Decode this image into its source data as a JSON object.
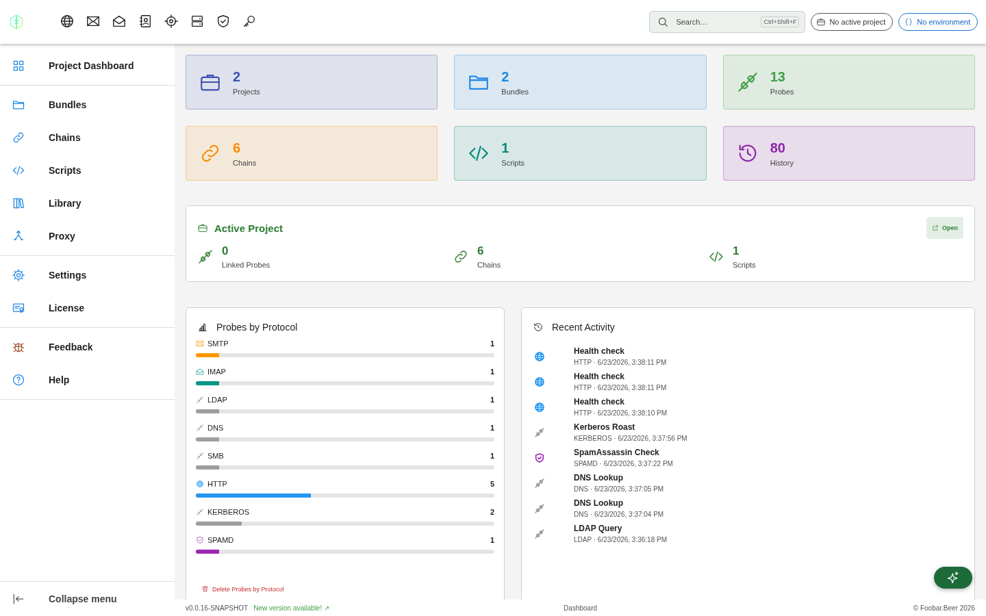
{
  "search": {
    "placeholder": "Search…",
    "shortcut": "Ctrl+Shift+F"
  },
  "project_chip": "No active project",
  "environment_chip": "No environment",
  "sidebar": {
    "groups": [
      [
        {
          "label": "Project Dashboard"
        }
      ],
      [
        {
          "label": "Bundles"
        },
        {
          "label": "Chains"
        },
        {
          "label": "Scripts"
        },
        {
          "label": "Library"
        },
        {
          "label": "Proxy"
        }
      ],
      [
        {
          "label": "Settings"
        },
        {
          "label": "License"
        }
      ],
      [
        {
          "label": "Feedback"
        },
        {
          "label": "Help"
        }
      ]
    ],
    "collapse": "Collapse menu"
  },
  "stats": [
    {
      "value": "2",
      "label": "Projects",
      "color": "#3f51b5"
    },
    {
      "value": "2",
      "label": "Bundles",
      "color": "#1e88e5"
    },
    {
      "value": "13",
      "label": "Probes",
      "color": "#43a047"
    },
    {
      "value": "6",
      "label": "Chains",
      "color": "#fb8c00"
    },
    {
      "value": "1",
      "label": "Scripts",
      "color": "#00897b"
    },
    {
      "value": "80",
      "label": "History",
      "color": "#8e24aa"
    }
  ],
  "active_project": {
    "title": "Active Project",
    "open": "Open",
    "metrics": [
      {
        "value": "0",
        "label": "Linked Probes"
      },
      {
        "value": "6",
        "label": "Chains"
      },
      {
        "value": "1",
        "label": "Scripts"
      }
    ]
  },
  "probes_by_protocol": {
    "title": "Probes by Protocol",
    "delete": "Delete Probes by Protocol",
    "rows": [
      {
        "name": "SMTP",
        "count": "1",
        "level": 0.077,
        "color": "#ff9800"
      },
      {
        "name": "IMAP",
        "count": "1",
        "level": 0.077,
        "color": "#009688"
      },
      {
        "name": "LDAP",
        "count": "1",
        "level": 0.077,
        "color": "#9e9e9e"
      },
      {
        "name": "DNS",
        "count": "1",
        "level": 0.077,
        "color": "#9e9e9e"
      },
      {
        "name": "SMB",
        "count": "1",
        "level": 0.077,
        "color": "#9e9e9e"
      },
      {
        "name": "HTTP",
        "count": "5",
        "level": 0.385,
        "color": "#2196f3"
      },
      {
        "name": "KERBEROS",
        "count": "2",
        "level": 0.154,
        "color": "#9e9e9e"
      },
      {
        "name": "SPAMD",
        "count": "1",
        "level": 0.077,
        "color": "#9c27b0"
      }
    ]
  },
  "recent_activity": {
    "title": "Recent Activity",
    "items": [
      {
        "title": "Health check",
        "meta": "HTTP · 6/23/2026, 3:38:11 PM",
        "color": "#2196f3"
      },
      {
        "title": "Health check",
        "meta": "HTTP · 6/23/2026, 3:38:11 PM",
        "color": "#2196f3"
      },
      {
        "title": "Health check",
        "meta": "HTTP · 6/23/2026, 3:38:10 PM",
        "color": "#2196f3"
      },
      {
        "title": "Kerberos Roast",
        "meta": "KERBEROS · 6/23/2026, 3:37:56 PM",
        "color": "#9e9e9e"
      },
      {
        "title": "SpamAssassin Check",
        "meta": "SPAMD · 6/23/2026, 3:37:22 PM",
        "color": "#9c27b0"
      },
      {
        "title": "DNS Lookup",
        "meta": "DNS · 6/23/2026, 3:37:05 PM",
        "color": "#9e9e9e"
      },
      {
        "title": "DNS Lookup",
        "meta": "DNS · 6/23/2026, 3:37:04 PM",
        "color": "#9e9e9e"
      },
      {
        "title": "LDAP Query",
        "meta": "LDAP · 6/23/2026, 3:36:18 PM",
        "color": "#9e9e9e"
      }
    ]
  },
  "footer": {
    "version": "v0.0.16-SNAPSHOT",
    "update": "New version available! ↗",
    "page": "Dashboard",
    "copyright": "© Foobar.Beer 2026"
  }
}
